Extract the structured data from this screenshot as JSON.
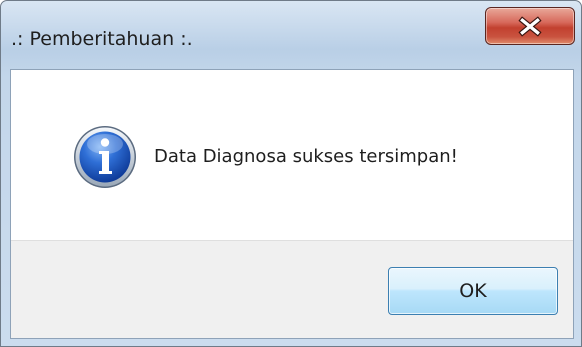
{
  "window": {
    "title": ".: Pemberitahuan :."
  },
  "dialog": {
    "message": "Data Diagnosa sukses tersimpan!",
    "icon": "information-icon",
    "ok_label": "OK"
  },
  "colors": {
    "title_bar": "#c3d6ea",
    "close_button": "#c9533f",
    "ok_button": "#bee6fd",
    "button_area": "#f0f0f0",
    "info_icon_blue": "#1c54b8"
  }
}
